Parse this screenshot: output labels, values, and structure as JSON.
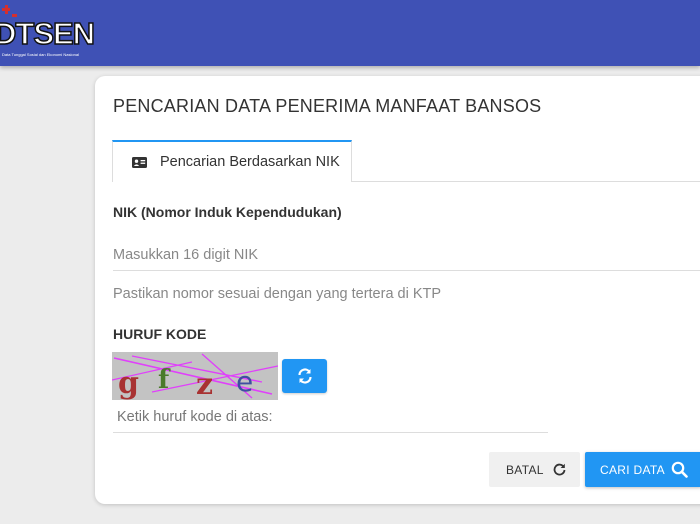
{
  "header": {
    "logo_text": "DTSEN",
    "logo_tagline": "Data Tunggal Sosial dan Ekonomi Nasional",
    "background_color": "#3f51b5"
  },
  "card": {
    "title": "PENCARIAN DATA PENERIMA MANFAAT BANSOS"
  },
  "tabs": [
    {
      "label": "Pencarian Berdasarkan NIK",
      "icon": "id-card-icon",
      "active": true
    }
  ],
  "nik": {
    "label": "NIK (Nomor Induk Kependudukan)",
    "placeholder": "Masukkan 16 digit NIK",
    "value": "",
    "helper": "Pastikan nomor sesuai dengan yang tertera di KTP"
  },
  "captcha": {
    "label": "HURUF KODE",
    "code": "gfze",
    "input_placeholder": "Ketik huruf kode di atas:",
    "input_value": ""
  },
  "actions": {
    "cancel_label": "BATAL",
    "search_label": "CARI DATA",
    "accent_color": "#2196f3"
  }
}
